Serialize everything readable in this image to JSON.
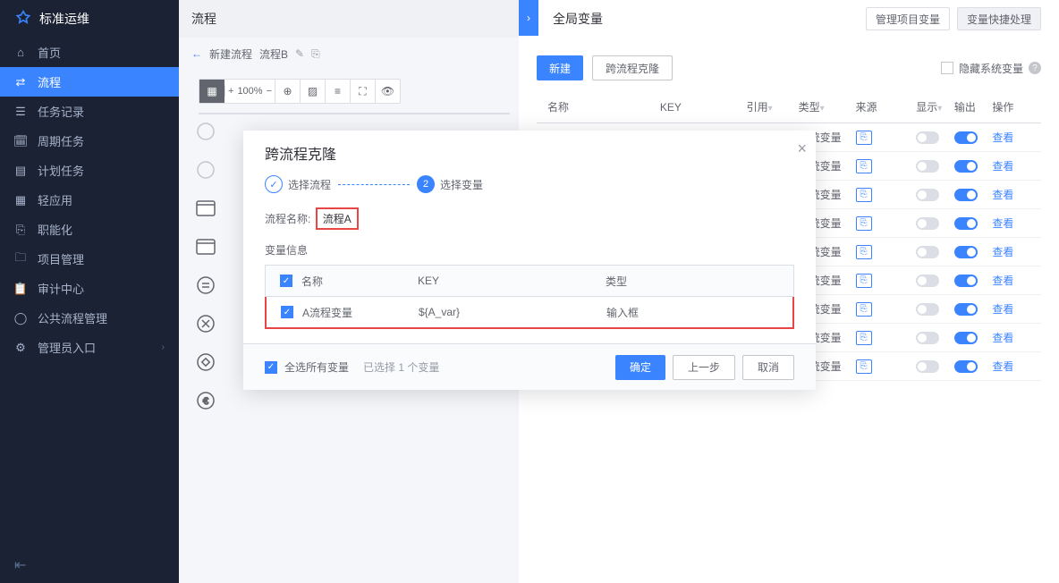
{
  "sidebar": {
    "brand": "标准运维",
    "items": [
      {
        "icon": "home",
        "label": "首页"
      },
      {
        "icon": "flow",
        "label": "流程",
        "active": true
      },
      {
        "icon": "task",
        "label": "任务记录"
      },
      {
        "icon": "cron",
        "label": "周期任务"
      },
      {
        "icon": "plan",
        "label": "计划任务"
      },
      {
        "icon": "app",
        "label": "轻应用"
      },
      {
        "icon": "func",
        "label": "职能化"
      },
      {
        "icon": "proj",
        "label": "项目管理"
      },
      {
        "icon": "audit",
        "label": "审计中心"
      },
      {
        "icon": "public",
        "label": "公共流程管理"
      },
      {
        "icon": "admin",
        "label": "管理员入口",
        "chev": true
      }
    ]
  },
  "workflow": {
    "title": "流程",
    "breadcrumb": {
      "back": "←",
      "new": "新建流程",
      "name": "流程B"
    },
    "zoom": "100%"
  },
  "panel": {
    "title": "全局变量",
    "header_btns": {
      "manage": "管理项目变量",
      "quick": "变量快捷处理"
    },
    "tabs": {
      "new": "新建",
      "clone": "跨流程克隆"
    },
    "hide_sys": "隐藏系统变量",
    "columns": {
      "name": "名称",
      "key": "KEY",
      "ref": "引用",
      "type": "类型",
      "src": "来源",
      "disp": "显示",
      "out": "输出",
      "act": "操作"
    },
    "row": {
      "type": "系统变量",
      "view": "查看"
    },
    "row_count": 9
  },
  "modal": {
    "title": "跨流程克隆",
    "steps": {
      "s1": "选择流程",
      "s2": "选择变量"
    },
    "flow_label": "流程名称:",
    "flow_name": "流程A",
    "var_info": "变量信息",
    "cols": {
      "name": "名称",
      "key": "KEY",
      "type": "类型"
    },
    "row": {
      "name": "A流程变量",
      "key": "${A_var}",
      "type": "输入框"
    },
    "select_all": "全选所有变量",
    "selected": "已选择 1 个变量",
    "btns": {
      "ok": "确定",
      "prev": "上一步",
      "cancel": "取消"
    }
  }
}
